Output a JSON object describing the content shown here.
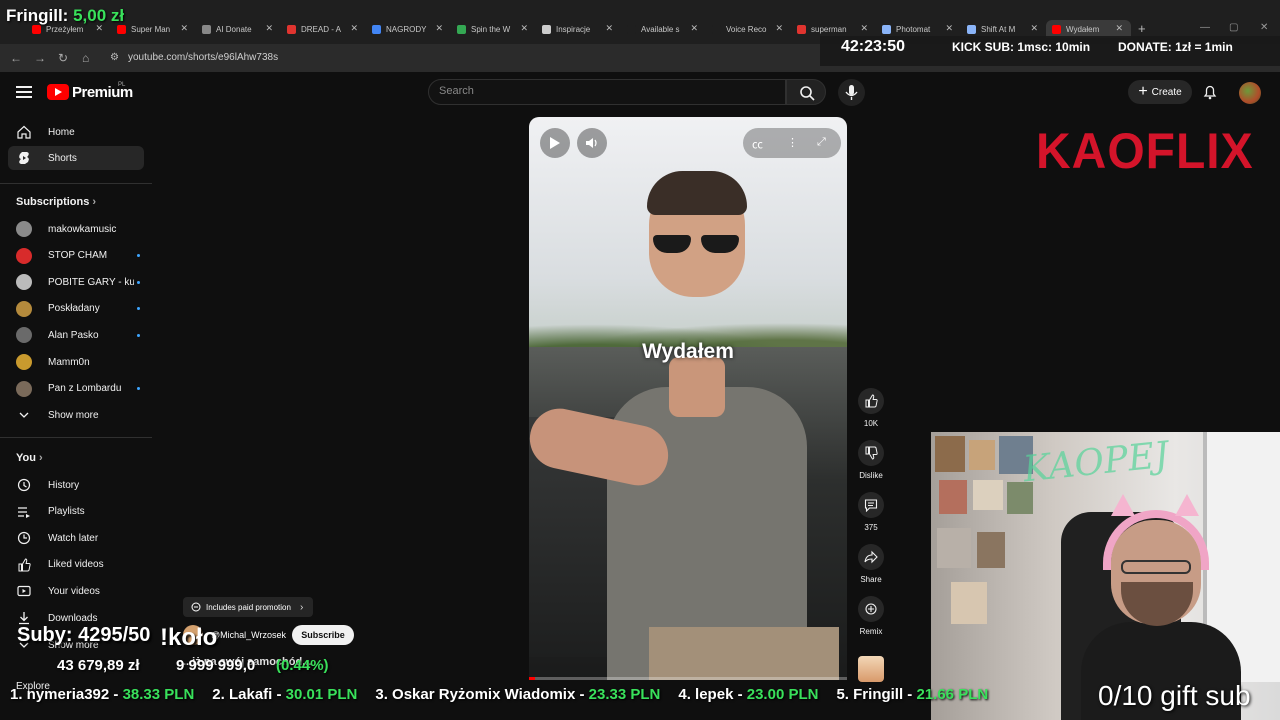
{
  "overlay": {
    "top_donor_name": "Fringill:",
    "top_donor_amount": "5,00 zł",
    "timer": "42:23:50",
    "kick_sub": "KICK SUB: 1msc: 10min",
    "donate_rule": "DONATE: 1zł = 1min",
    "subs_label": "Suby: 4295/50",
    "kolo": "!koło",
    "goal_current": "43 679,89 zł",
    "goal_target": "9 999 999,0",
    "goal_percent": "(0.44%)",
    "gift_sub": "0/10 gift sub",
    "kaoflix": "KAOFLIX",
    "webcam_scribble": "KAOPEJ",
    "ticker": [
      {
        "name": "1. nymeria392 - ",
        "amount": "38.33 PLN"
      },
      {
        "name": "2. Lakafi - ",
        "amount": "30.01 PLN"
      },
      {
        "name": "3. Oskar Ryżomix Wiadomix - ",
        "amount": "23.33 PLN"
      },
      {
        "name": "4. lepek - ",
        "amount": "23.00 PLN"
      },
      {
        "name": "5. Fringill - ",
        "amount": "21.66 PLN"
      }
    ]
  },
  "browser": {
    "tabs": [
      {
        "label": "Przeżyłem",
        "color": "#ff0000"
      },
      {
        "label": "Super Man",
        "color": "#ff0000"
      },
      {
        "label": "AI Donate",
        "color": "#888888"
      },
      {
        "label": "DREAD - A",
        "color": "#e0342f"
      },
      {
        "label": "NAGRODY",
        "color": "#4285f4"
      },
      {
        "label": "Spin the W",
        "color": "#34a853"
      },
      {
        "label": "Inspiracje",
        "color": "#cccccc"
      },
      {
        "label": "Available s",
        "color": "#1f1f1f"
      },
      {
        "label": "Voice Reco",
        "color": "#1f1f1f"
      },
      {
        "label": "superman",
        "color": "#e0342f"
      },
      {
        "label": "Photomat",
        "color": "#8ab4f8"
      },
      {
        "label": "Shift At M",
        "color": "#8ab4f8"
      },
      {
        "label": "Wydałem",
        "color": "#ff0000"
      }
    ],
    "url": "youtube.com/shorts/e96lAhw738s"
  },
  "header": {
    "brand": "Premium",
    "brand_sup": "PL",
    "search_placeholder": "Search",
    "create_label": "Create"
  },
  "sidebar": {
    "main": [
      {
        "label": "Home"
      },
      {
        "label": "Shorts"
      }
    ],
    "subscriptions_title": "Subscriptions",
    "subscriptions": [
      {
        "label": "makowkamusic",
        "color": "#8a8a8a",
        "dot": false
      },
      {
        "label": "STOP CHAM",
        "color": "#d82b2b",
        "dot": true
      },
      {
        "label": "POBITE GARY - kuc...",
        "color": "#bbbbbb",
        "dot": true
      },
      {
        "label": "Poskładany",
        "color": "#b48a3c",
        "dot": true
      },
      {
        "label": "Alan Pasko",
        "color": "#6a6a6a",
        "dot": true
      },
      {
        "label": "Mamm0n",
        "color": "#c99a2e",
        "dot": false
      },
      {
        "label": "Pan z Lombardu",
        "color": "#7a6a5a",
        "dot": true
      }
    ],
    "show_more": "Show more",
    "you_title": "You",
    "you": [
      {
        "label": "History"
      },
      {
        "label": "Playlists"
      },
      {
        "label": "Watch later"
      },
      {
        "label": "Liked videos"
      },
      {
        "label": "Your videos"
      },
      {
        "label": "Downloads"
      }
    ],
    "show_more_2": "Show more",
    "explore": "Explore"
  },
  "short": {
    "caption": "Wydałem",
    "progress": 0.02,
    "paid_promotion": "Includes paid promotion",
    "channel": "@Michal_Wrzosek",
    "subscribe": "Subscribe",
    "description": "Wydałem 24 000 zł, żeby przetestować, ile zarobi na swój samochód...",
    "description_visible": "...iż na swój samochód..."
  },
  "actions": {
    "likes": "10K",
    "dislike": "Dislike",
    "comments": "375",
    "share": "Share",
    "remix": "Remix"
  }
}
